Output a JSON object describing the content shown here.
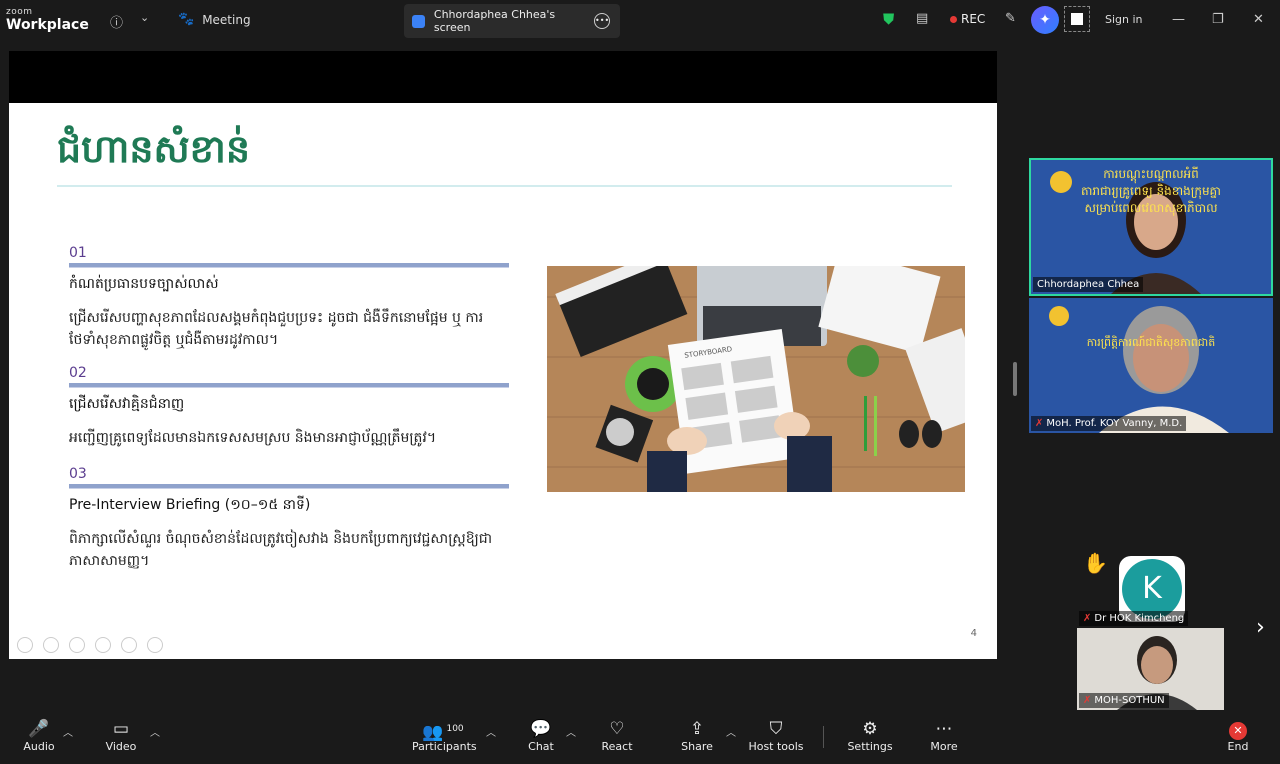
{
  "app": {
    "brand_small": "zoom",
    "brand_name": "Workplace"
  },
  "topbar": {
    "meeting_label": "Meeting",
    "screen_tab_label": "Chhordaphea Chhea's screen",
    "rec_label": "REC",
    "signin_label": "Sign in"
  },
  "slide": {
    "title": "ជំហានសំខាន់",
    "items": [
      {
        "num": "01",
        "heading": "កំណត់ប្រធានបទច្បាស់លាស់",
        "desc": "ជ្រើសរើសបញ្ហាសុខភាពដែលសង្គមកំពុងជួបប្រទះ ដូចជា ជំងឺទឹកនោមផ្អែម ឬ ការថែទាំសុខភាពផ្លូវចិត្ត ឬជំងឺតាមរដូវកាល។"
      },
      {
        "num": "02",
        "heading": "ជ្រើសរើសវាគ្មិនជំនាញ",
        "desc": "អញ្ជើញគ្រូពេទ្យដែលមានឯកទេសសមស្រប និងមានអាជ្ញាប័ណ្ណត្រឹមត្រូវ។"
      },
      {
        "num": "03",
        "heading": "Pre-Interview Briefing (១០–១៥ នាទី)",
        "desc": "ពិភាក្សាលើសំណួរ ចំណុចសំខាន់ដែលត្រូវចៀសវាង និងបកប្រែពាក្យវេជ្ជសាស្ត្រឱ្យជាភាសាសាមញ្ញ។"
      }
    ],
    "page_number": "4",
    "image_caption": "STORYBOARD"
  },
  "participants": {
    "tile1": {
      "name": "Chhordaphea Chhea",
      "banner": "ការបណ្តុះបណ្តាលអំពី\nតារាជារ្យគ្រូពេទ្យ និងខាងក្រុមគ្នា\nសម្រាប់ពេលវេលាសុខាភិបាល"
    },
    "tile2": {
      "name": "MoH. Prof. KOY Vanny, M.D.",
      "banner": "ការព្រឹត្តិការណ៍ជាតិសុខភាពជាតិ"
    },
    "tile3": {
      "name": "Dr HOK Kimcheng",
      "initial": "K"
    },
    "tile4": {
      "name": "MOH-SOTHUN"
    }
  },
  "toolbar": {
    "audio": "Audio",
    "video": "Video",
    "participants": "Participants",
    "participants_count": "100",
    "chat": "Chat",
    "react": "React",
    "share": "Share",
    "host_tools": "Host tools",
    "settings": "Settings",
    "more": "More",
    "end": "End"
  },
  "colors": {
    "slide_title": "#1f7a55",
    "number": "#5b3d8f",
    "rec_dot": "#e53935",
    "tile_bg": "#264f9c",
    "active_border": "#2ed8a0"
  },
  "icons": [
    "info-icon",
    "chevron-down-icon",
    "paw-icon",
    "screen-share-icon",
    "more-icon",
    "shield-icon",
    "notes-icon",
    "rec-dot-icon",
    "pen-icon",
    "ai-companion-icon",
    "layout-icon",
    "minimize-icon",
    "restore-icon",
    "close-icon",
    "mic-muted-icon",
    "video-icon",
    "participants-icon",
    "chat-icon",
    "heart-icon",
    "share-screen-icon",
    "host-shield-icon",
    "gear-icon",
    "more-dots-icon",
    "end-icon",
    "raised-hand-icon",
    "chevron-right-icon"
  ]
}
